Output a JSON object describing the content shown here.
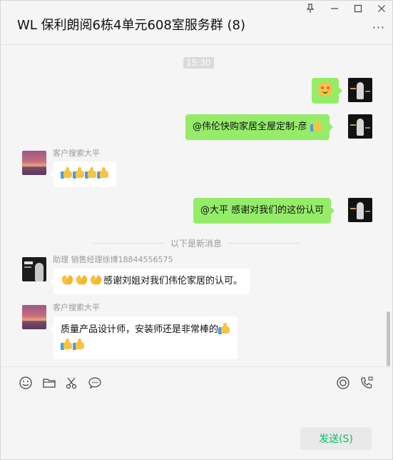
{
  "window": {
    "title": "WL 保利朗阅6栋4单元608室服务群 (8)",
    "controls": [
      "pin-icon",
      "minimize-icon",
      "maximize-icon",
      "close-icon"
    ],
    "more_label": "···"
  },
  "chat": {
    "timestamp": "15:30",
    "messages": [
      {
        "side": "right",
        "sender": "",
        "emojis": [
          "smiley"
        ]
      },
      {
        "side": "right",
        "sender": "",
        "text": "@伟伦快购家居全屋定制-彦",
        "emojis": [
          "thumbs-up"
        ]
      },
      {
        "side": "left",
        "sender": "客户搜索大平",
        "emojis": [
          "thumbs-up",
          "thumbs-up",
          "thumbs-up",
          "thumbs-up"
        ]
      },
      {
        "side": "right",
        "sender": "",
        "text": "@大平 感谢对我们的这份认可"
      },
      {
        "side": "left",
        "sender": "助理 销售经理徐博18844556575",
        "text": "感谢刘姐对我们伟伦家居的认可。",
        "emojis": [
          "pray",
          "pray",
          "pray"
        ]
      },
      {
        "side": "left",
        "sender": "客户搜索大平",
        "text": "质量产品设计师，安装师还是非常棒的",
        "emojis": [
          "thumbs-up",
          "thumbs-up",
          "thumbs-up"
        ]
      }
    ],
    "divider_text": "以下是新消息"
  },
  "toolbar": {
    "icons": [
      "emoji-icon",
      "folder-icon",
      "scissors-icon",
      "chat-bubble-icon",
      "live-icon",
      "call-icon"
    ]
  },
  "compose": {
    "send_label": "发送(S)"
  },
  "colors": {
    "bubble_self": "#95ec69",
    "bubble_other": "#ffffff",
    "send_text": "#07c160"
  }
}
